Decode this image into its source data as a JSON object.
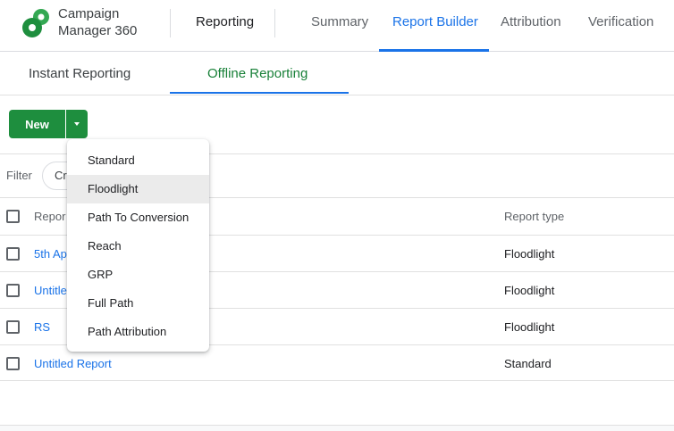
{
  "app": {
    "name_line1": "Campaign",
    "name_line2": "Manager 360",
    "section": "Reporting"
  },
  "colors": {
    "brand_green": "#1e8e3e",
    "link_blue": "#1a73e8",
    "active_subtab": "#188038"
  },
  "top_tabs": [
    {
      "label": "Summary",
      "active": false
    },
    {
      "label": "Report Builder",
      "active": true
    },
    {
      "label": "Attribution",
      "active": false
    },
    {
      "label": "Verification",
      "active": false
    }
  ],
  "sub_tabs": [
    {
      "label": "Instant Reporting",
      "active": false
    },
    {
      "label": "Offline Reporting",
      "active": true
    }
  ],
  "toolbar": {
    "new_label": "New",
    "new_dropdown_icon": "arrow-drop-down-icon"
  },
  "filter": {
    "label": "Filter",
    "chip_text": "Cr"
  },
  "table": {
    "headers": {
      "name": "Repor",
      "type": "Report type"
    },
    "rows": [
      {
        "name": "5th Ap",
        "type": "Floodlight"
      },
      {
        "name": "Untitle",
        "type": "Floodlight"
      },
      {
        "name": "RS",
        "type": "Floodlight"
      },
      {
        "name": "Untitled Report",
        "type": "Standard"
      }
    ]
  },
  "new_menu": {
    "items": [
      "Standard",
      "Floodlight",
      "Path To Conversion",
      "Reach",
      "GRP",
      "Full Path",
      "Path Attribution"
    ],
    "highlighted": "Floodlight"
  }
}
